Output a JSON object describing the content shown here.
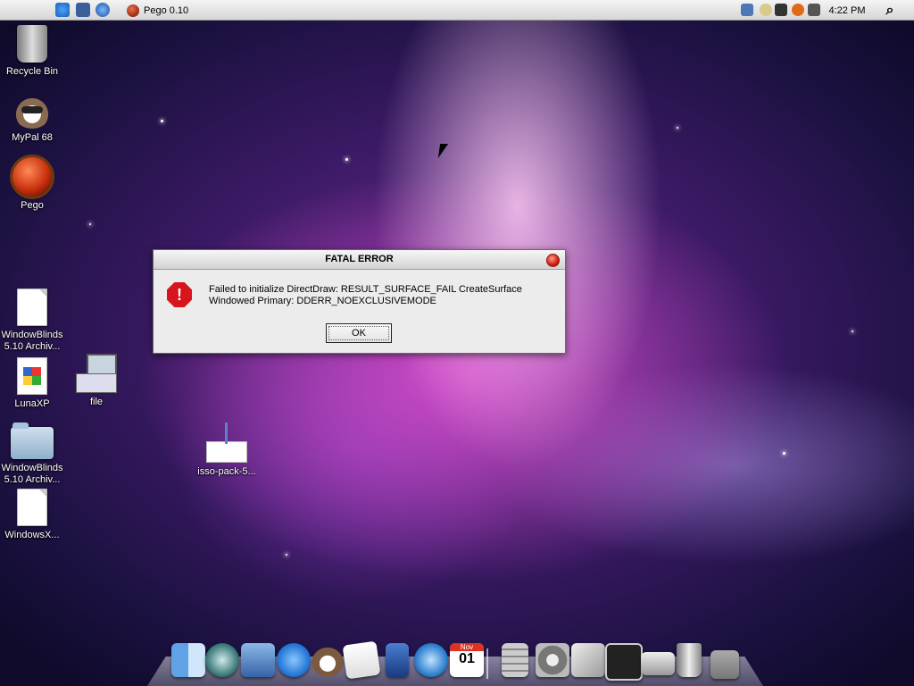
{
  "menubar": {
    "apple_icon": "",
    "app_name": "Pego 0.10",
    "time": "4:22 PM",
    "search_icon": "⌕"
  },
  "desktop": {
    "icons": [
      {
        "label": "Recycle Bin",
        "icon": "recycle-bin"
      },
      {
        "label": "MyPal 68",
        "icon": "raccoon"
      },
      {
        "label": "Pego",
        "icon": "red-ball"
      },
      {
        "label": "WindowBlinds 5.10 Archiv...",
        "icon": "document"
      },
      {
        "label": "LunaXP",
        "icon": "luna-image"
      },
      {
        "label": "file",
        "icon": "computer"
      },
      {
        "label": "WindowBlinds 5.10 Archiv...",
        "icon": "folder"
      },
      {
        "label": "isso-pack-5...",
        "icon": "envelope"
      },
      {
        "label": "WindowsX...",
        "icon": "document"
      }
    ]
  },
  "dialog": {
    "title": "FATAL ERROR",
    "message": "Failed to initialize DirectDraw: RESULT_SURFACE_FAIL CreateSurface Windowed Primary: DDERR_NOEXCLUSIVEMODE",
    "ok_label": "OK",
    "stop_glyph": "!"
  },
  "dock": {
    "calendar_month": "Nov",
    "calendar_day": "01"
  },
  "colors": {
    "error_red": "#d8141c",
    "menubar_bg": "#e6e6e6",
    "wallpaper_pink": "#e050d0"
  }
}
